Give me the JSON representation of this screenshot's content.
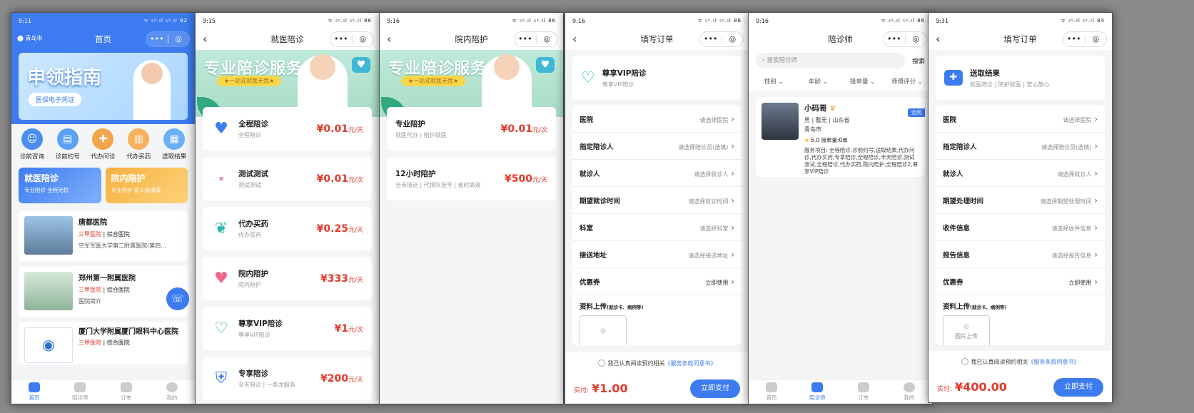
{
  "p1": {
    "time": "9:11",
    "icons": "▮▮ ◉ ✱",
    "right": "ᯤ ₅ᵍ.ıl ₅ᵍ.ıl 82",
    "city": "青岛市",
    "title": "首页",
    "banner_title": "申领指南",
    "banner_btn": "医保电子凭证",
    "quick": [
      {
        "icon": "doctor-icon",
        "label": "诊前咨询"
      },
      {
        "icon": "clipboard-icon",
        "label": "诊前约号"
      },
      {
        "icon": "medicine-icon",
        "label": "代办问诊"
      },
      {
        "icon": "pill-box-icon",
        "label": "代办买药"
      },
      {
        "icon": "report-icon",
        "label": "送取结果"
      }
    ],
    "promo": [
      {
        "title": "就医陪诊",
        "sub": "专业陪诊 全程无忧"
      },
      {
        "title": "院内陪护",
        "sub": "专业陪护 家人般温暖"
      }
    ],
    "hospitals": [
      {
        "name": "唐都医院",
        "level": "三甲医院",
        "type": "综合医院",
        "desc": "空军军医大学第二附属医院(第四..."
      },
      {
        "name": "郑州第一附属医院",
        "level": "三甲医院",
        "type": "综合医院",
        "desc": "医院简介"
      },
      {
        "name": "厦门大学附属厦门眼科中心医院",
        "level": "三甲医院",
        "type": "综合医院",
        "desc": ""
      }
    ],
    "tabs": [
      "首页",
      "陪诊师",
      "订单",
      "我的"
    ]
  },
  "p2": {
    "time": "9:15",
    "icons": "▣ ◉ ◉ ✱",
    "right": "ᯤ ₅ᵍ.ıl ₅ᵍ.ıl 86",
    "title": "就医陪诊",
    "banner_title": "专业陪诊服务",
    "banner_sub": "★一站式就医无忧★",
    "services": [
      {
        "icon": "heart-icon",
        "glyph": "♥",
        "color": "#3d7bf0",
        "name": "全程陪诊",
        "sub": "全程陪诊",
        "price": "¥0.01",
        "unit": "元/天"
      },
      {
        "icon": "test-icon",
        "glyph": "▪",
        "color": "#d9a",
        "name": "测试测试",
        "sub": "测试测试",
        "price": "¥0.01",
        "unit": "元/次"
      },
      {
        "icon": "hands-icon",
        "glyph": "❦",
        "color": "#2bb7b0",
        "name": "代办买药",
        "sub": "代办买药",
        "price": "¥0.25",
        "unit": "元/天"
      },
      {
        "icon": "heart-icon",
        "glyph": "♥",
        "color": "#f0668a",
        "name": "院内陪护",
        "sub": "院内陪护",
        "price": "¥333",
        "unit": "元/天"
      },
      {
        "icon": "handshake-icon",
        "glyph": "♡",
        "color": "#2bb7b0",
        "name": "尊享VIP陪诊",
        "sub": "尊享VIP陪诊",
        "price": "¥1",
        "unit": "元/次"
      },
      {
        "icon": "shield-icon",
        "glyph": "⛨",
        "color": "#3d7bf0",
        "name": "专享陪诊",
        "sub": "全天陪诊 | 一条龙服务",
        "price": "¥200",
        "unit": "元/天"
      }
    ]
  },
  "p3": {
    "time": "9:16",
    "icons": "▣ ◉ ◉ ✱",
    "right": "ᯤ ₅ᵍ.ıl ₅ᵍ.ıl 86",
    "title": "院内陪护",
    "banner_title": "专业陪诊服务",
    "banner_sub": "★一站式就医无忧★",
    "services": [
      {
        "name": "专业陪护",
        "sub": "就医代办 | 陪护就医",
        "price": "¥0.01",
        "unit": "元/次"
      },
      {
        "name": "12小时陪护",
        "sub": "全市接送 | 代排队挂号 | 省时高效",
        "price": "¥500",
        "unit": "元/天"
      }
    ]
  },
  "p4": {
    "time": "9:16",
    "icons": "▣ ◉ ◉ ✱",
    "right": "ᯤ ₅ᵍ.ıl ₅ᵍ.ıl 86",
    "title": "填写订单",
    "svc_name": "尊享VIP陪诊",
    "svc_sub": "尊享VIP陪诊",
    "rows": [
      {
        "label": "医院",
        "value": "请选择医院"
      },
      {
        "label": "指定陪诊人",
        "value": "请选择陪诊员(选填)"
      },
      {
        "label": "就诊人",
        "value": "请选择就诊人"
      },
      {
        "label": "期望就诊时间",
        "value": "请选择就诊时间"
      },
      {
        "label": "科室",
        "value": "请选择科室"
      },
      {
        "label": "接送地址",
        "value": "请选择接送地址"
      },
      {
        "label": "优惠券",
        "value": "立即使用"
      }
    ],
    "upload": "资料上传",
    "upload_hint": "(就诊卡、病例等)",
    "agree": "我已认真阅读预约相关",
    "agree_link": "《服务条款同意书》",
    "total_label": "实付:",
    "total": "¥1.00",
    "pay": "立即支付"
  },
  "p5": {
    "time": "9:16",
    "icons": "▣ ◉ ◉ ✱",
    "right": "ᯤ ₅ᵍ.ıl ₅ᵍ.ıl 86",
    "title": "陪诊师",
    "search_ph": "搜索陪诊师",
    "search_btn": "搜索",
    "filters": [
      "性别",
      "年龄",
      "接单量",
      "师傅评分"
    ],
    "escort": {
      "name": "小码哥",
      "badge": "空闲",
      "info": "男 | 暂无 | 山东省",
      "city": "青岛市",
      "rating": "5.0",
      "orders": "接单量:0单",
      "services": "服务项目: 全程陪诊,诊前约号,送取结果,代办问诊,代办买药,专享陪诊,全程陪诊,半天陪诊,测试测试,全程陪诊,代办买药,院内陪护,全程陪诊2,尊享VIP陪诊"
    },
    "tabs": [
      "首页",
      "陪诊师",
      "订单",
      "我的"
    ]
  },
  "p6": {
    "time": "9:31",
    "icons": "▣ ◉ ◉ ✱",
    "right": "ᯤ ₅ᵍ.ıl ₅ᵍ.ıl 84",
    "title": "填写订单",
    "svc_name": "送取结果",
    "svc_sub": "就医陪诊 | 陪护就医 | 安心放心",
    "rows": [
      {
        "label": "医院",
        "value": "请选择医院"
      },
      {
        "label": "指定陪诊人",
        "value": "请选择陪诊员(选填)"
      },
      {
        "label": "就诊人",
        "value": "请选择就诊人"
      },
      {
        "label": "期望处理时间",
        "value": "请选择期望处理时间"
      },
      {
        "label": "收件信息",
        "value": "请选择收件信息"
      },
      {
        "label": "报告信息",
        "value": "请选择报告信息"
      },
      {
        "label": "优惠券",
        "value": "立即使用"
      }
    ],
    "upload": "资料上传",
    "upload_hint": "(就诊卡、病例等)",
    "upload_box": "图片上传",
    "agree": "我已认真阅读预约相关",
    "agree_link": "《服务条款同意书》",
    "total_label": "实付:",
    "total": "¥400.00",
    "pay": "立即支付"
  }
}
